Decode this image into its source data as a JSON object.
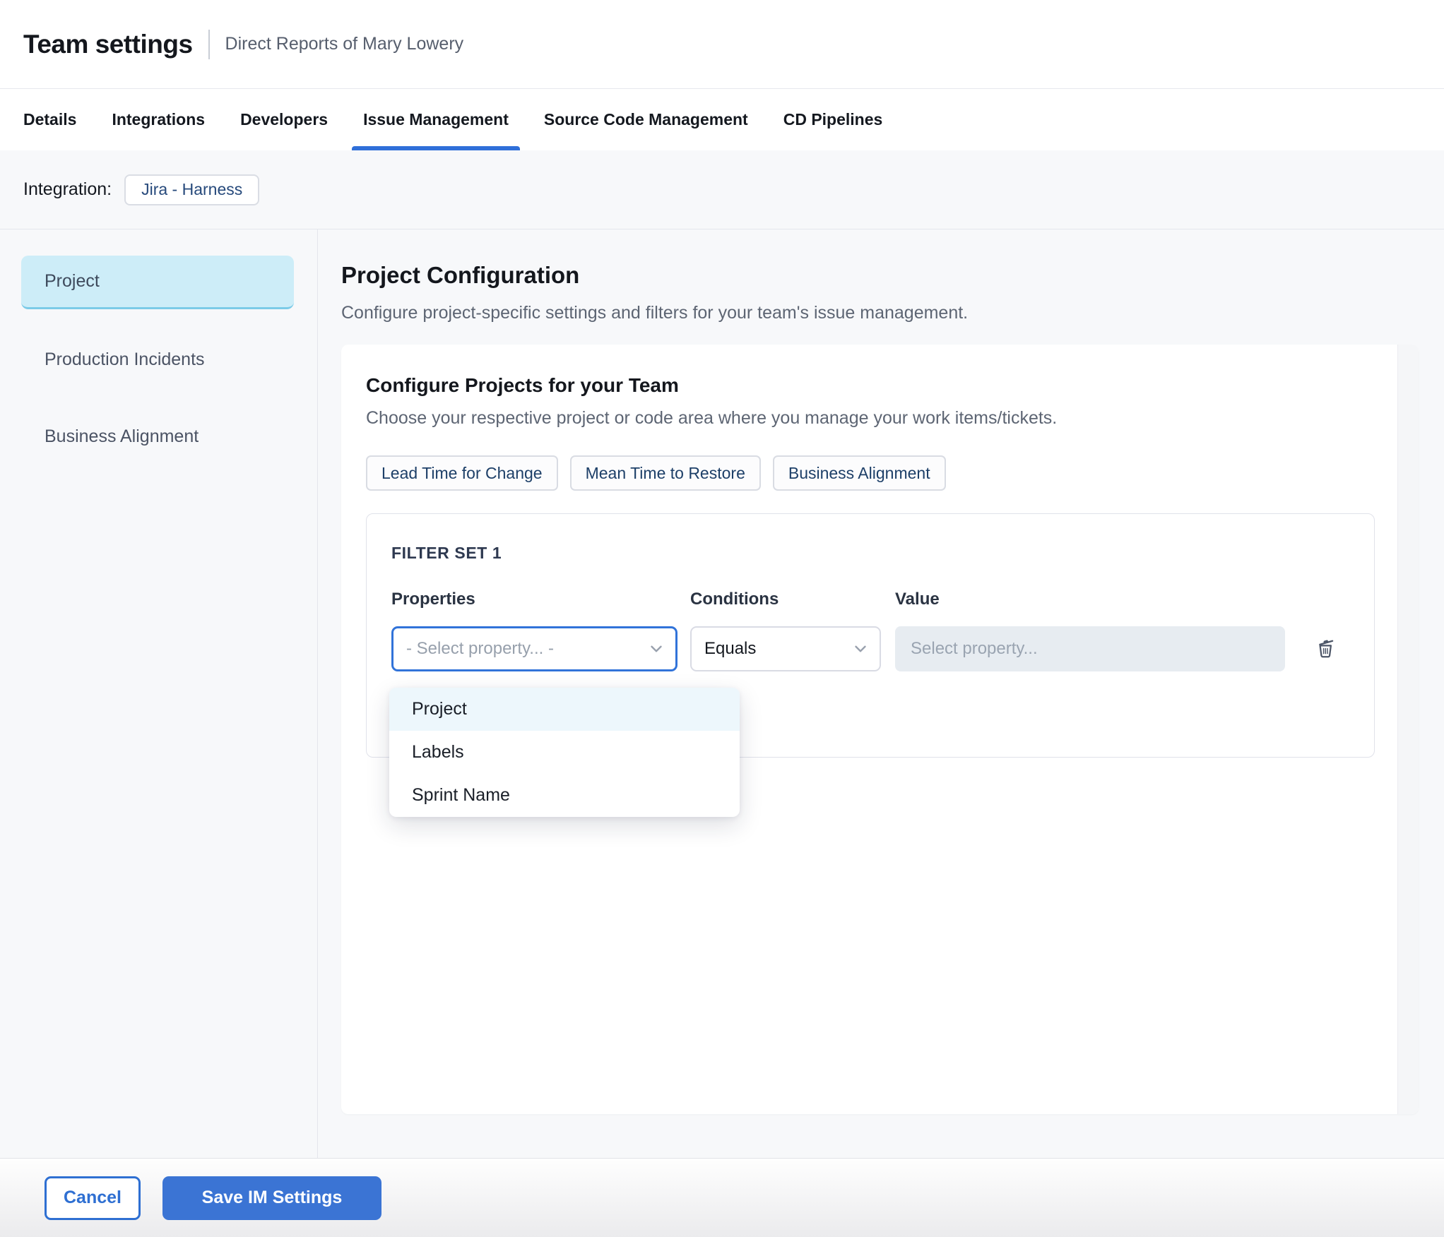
{
  "header": {
    "title": "Team settings",
    "subtitle": "Direct Reports of Mary Lowery"
  },
  "tabs": [
    {
      "label": "Details",
      "active": false
    },
    {
      "label": "Integrations",
      "active": false
    },
    {
      "label": "Developers",
      "active": false
    },
    {
      "label": "Issue Management",
      "active": true
    },
    {
      "label": "Source Code Management",
      "active": false
    },
    {
      "label": "CD Pipelines",
      "active": false
    }
  ],
  "integration": {
    "label": "Integration:",
    "value": "Jira - Harness"
  },
  "sidebar": {
    "items": [
      {
        "label": "Project",
        "selected": true
      },
      {
        "label": "Production Incidents",
        "selected": false
      },
      {
        "label": "Business Alignment",
        "selected": false
      }
    ]
  },
  "main": {
    "title": "Project Configuration",
    "description": "Configure project-specific settings and filters for your team's issue management.",
    "card": {
      "title": "Configure Projects for your Team",
      "description": "Choose your respective project or code area where you manage your work items/tickets.",
      "chips": [
        "Lead Time for Change",
        "Mean Time to Restore",
        "Business Alignment"
      ],
      "filter_set": {
        "title": "FILTER SET 1",
        "columns": [
          "Properties",
          "Conditions",
          "Value"
        ],
        "property_select": {
          "value": "- Select property... -"
        },
        "condition_select": {
          "value": "Equals"
        },
        "value_input": {
          "placeholder": "Select property..."
        },
        "dropdown": {
          "options": [
            {
              "label": "Project",
              "highlighted": true
            },
            {
              "label": "Labels",
              "highlighted": false
            },
            {
              "label": "Sprint Name",
              "highlighted": false
            }
          ]
        }
      }
    }
  },
  "footer": {
    "cancel_label": "Cancel",
    "save_label": "Save IM Settings"
  },
  "colors": {
    "accent_blue": "#3b74d4",
    "tab_underline": "#2f6fd9",
    "focus_border": "#3173d9",
    "selected_sidebar_bg": "#cdedf8",
    "selected_sidebar_border": "#7ccbe8",
    "dropdown_highlight": "#edf7fc",
    "chip_text": "#1d3f68",
    "content_bg": "#f7f8fa",
    "disabled_input_bg": "#e7ecf1"
  }
}
